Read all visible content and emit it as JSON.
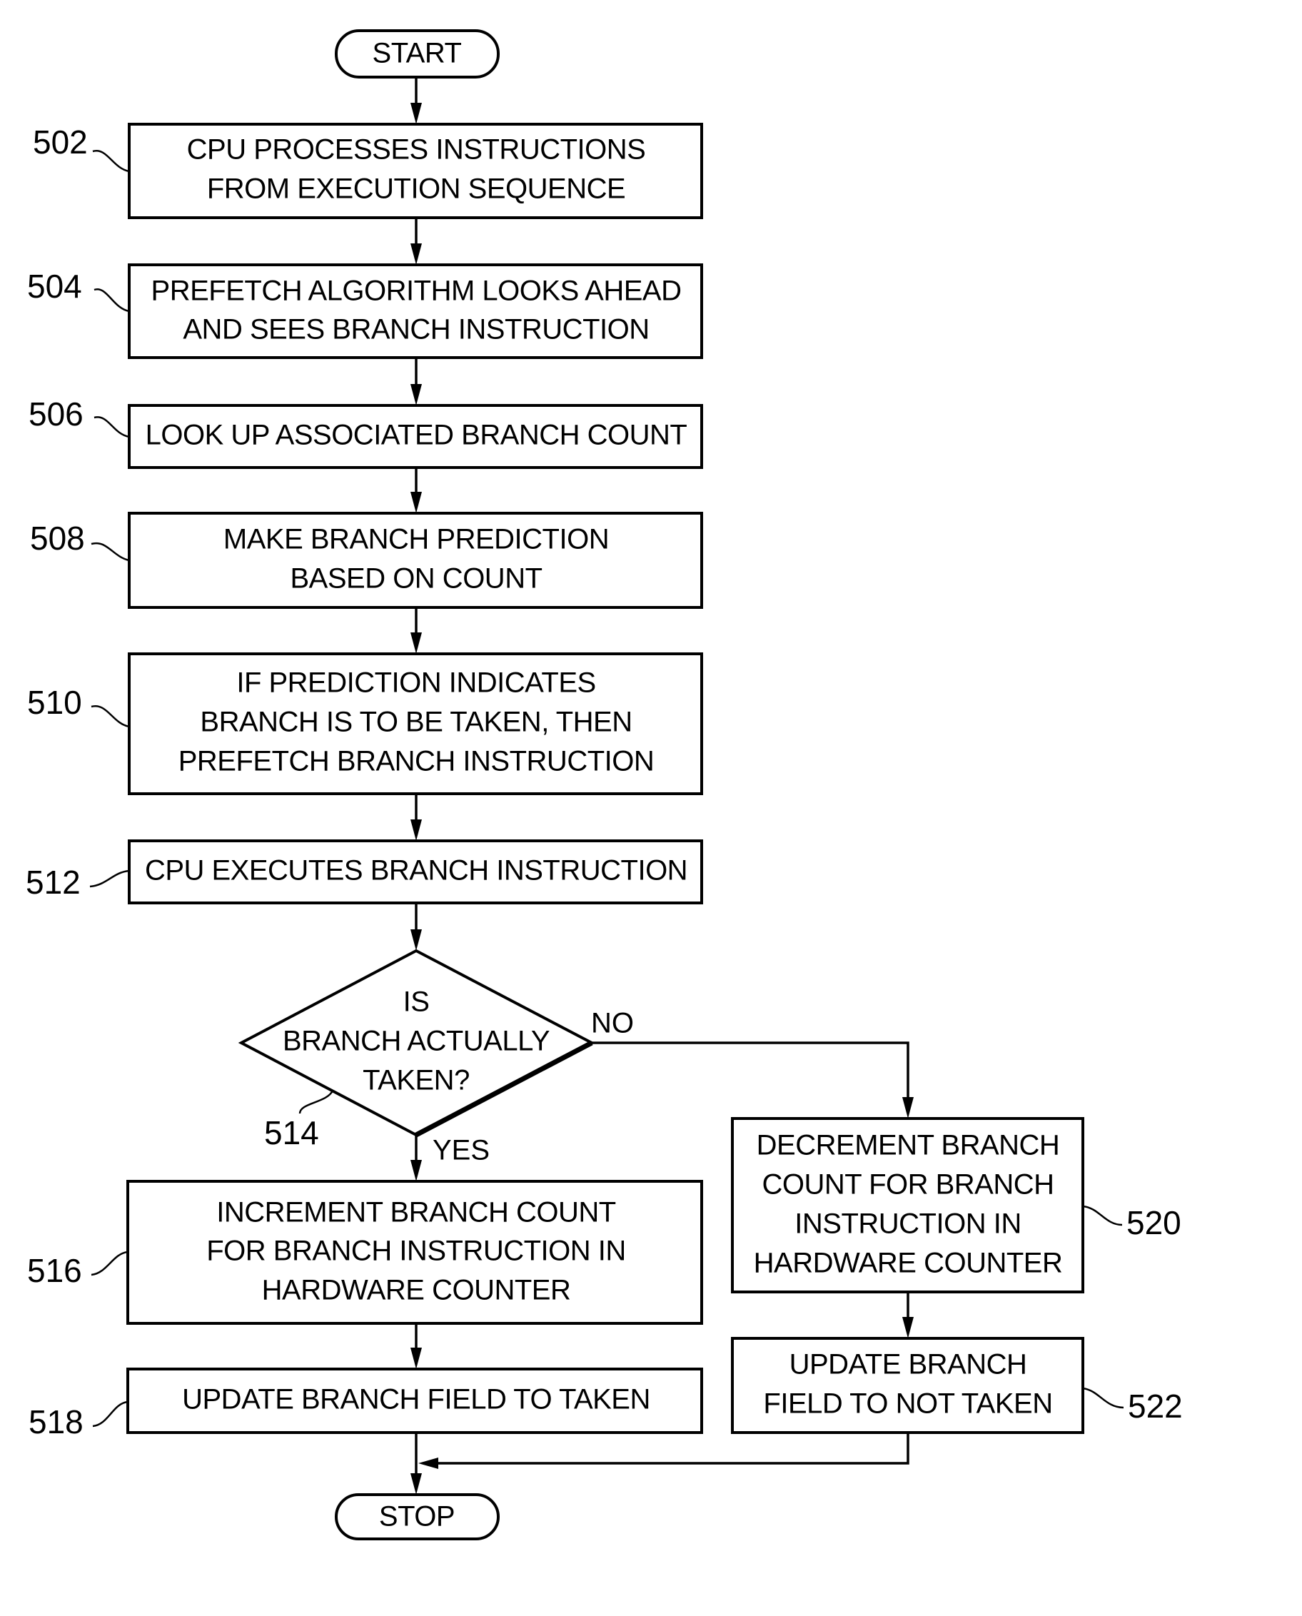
{
  "diagram": {
    "type": "flowchart",
    "terminals": {
      "start": "START",
      "stop": "STOP"
    },
    "steps": [
      {
        "id": "502",
        "ref": "502",
        "lines": [
          "CPU PROCESSES INSTRUCTIONS",
          "FROM EXECUTION SEQUENCE"
        ]
      },
      {
        "id": "504",
        "ref": "504",
        "lines": [
          "PREFETCH ALGORITHM LOOKS AHEAD",
          "AND SEES BRANCH INSTRUCTION"
        ]
      },
      {
        "id": "506",
        "ref": "506",
        "lines": [
          "LOOK UP ASSOCIATED BRANCH COUNT"
        ]
      },
      {
        "id": "508",
        "ref": "508",
        "lines": [
          "MAKE BRANCH PREDICTION",
          "BASED ON COUNT"
        ]
      },
      {
        "id": "510",
        "ref": "510",
        "lines": [
          "IF PREDICTION INDICATES",
          "BRANCH IS TO BE TAKEN, THEN",
          "PREFETCH BRANCH INSTRUCTION"
        ]
      },
      {
        "id": "512",
        "ref": "512",
        "lines": [
          "CPU EXECUTES BRANCH INSTRUCTION"
        ]
      },
      {
        "id": "516",
        "ref": "516",
        "lines": [
          "INCREMENT BRANCH COUNT",
          "FOR BRANCH INSTRUCTION IN",
          "HARDWARE COUNTER"
        ]
      },
      {
        "id": "518",
        "ref": "518",
        "lines": [
          "UPDATE BRANCH FIELD TO TAKEN"
        ]
      },
      {
        "id": "520",
        "ref": "520",
        "lines": [
          "DECREMENT BRANCH",
          "COUNT FOR BRANCH",
          "INSTRUCTION IN",
          "HARDWARE COUNTER"
        ]
      },
      {
        "id": "522",
        "ref": "522",
        "lines": [
          "UPDATE BRANCH",
          "FIELD TO NOT TAKEN"
        ]
      }
    ],
    "decision": {
      "id": "514",
      "ref": "514",
      "lines": [
        "IS",
        "BRANCH ACTUALLY",
        "TAKEN?"
      ],
      "yes_label": "YES",
      "no_label": "NO"
    },
    "edges": [
      {
        "from": "start",
        "to": "502"
      },
      {
        "from": "502",
        "to": "504"
      },
      {
        "from": "504",
        "to": "506"
      },
      {
        "from": "506",
        "to": "508"
      },
      {
        "from": "508",
        "to": "510"
      },
      {
        "from": "510",
        "to": "512"
      },
      {
        "from": "512",
        "to": "514"
      },
      {
        "from": "514",
        "to": "516",
        "label": "YES"
      },
      {
        "from": "514",
        "to": "520",
        "label": "NO"
      },
      {
        "from": "516",
        "to": "518"
      },
      {
        "from": "520",
        "to": "522"
      },
      {
        "from": "518",
        "to": "stop"
      },
      {
        "from": "522",
        "to": "stop"
      }
    ]
  }
}
